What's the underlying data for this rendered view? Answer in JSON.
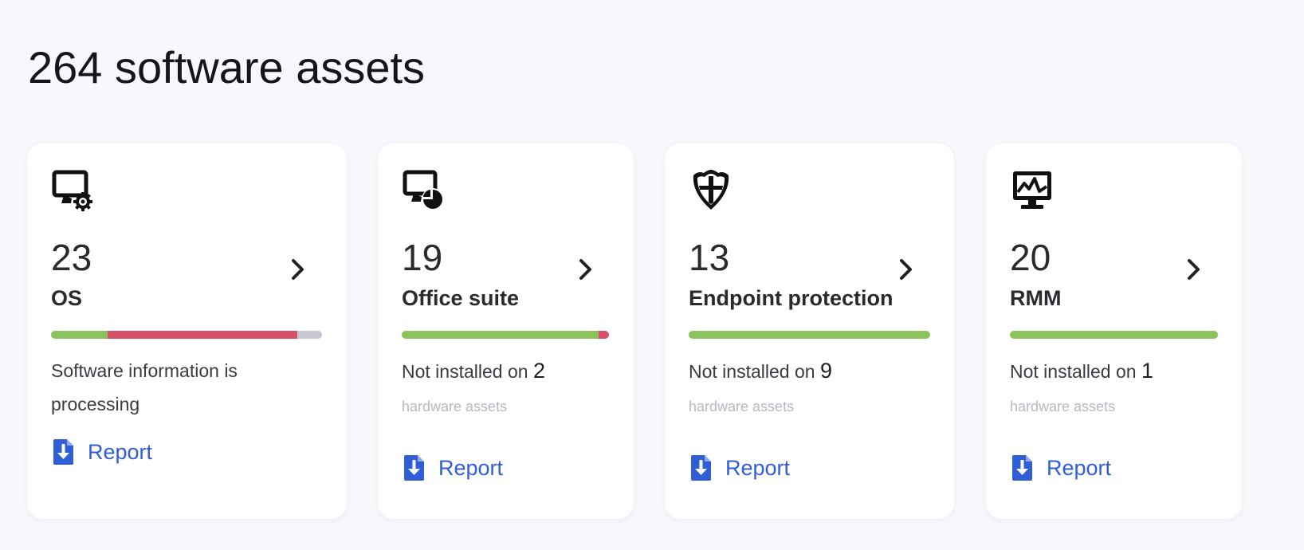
{
  "page": {
    "title": "264 software assets"
  },
  "colors": {
    "installed": "#8bc45c",
    "not_installed": "#d9506a",
    "processing": "#c8c8d2",
    "link": "#2f5ed6"
  },
  "cards": [
    {
      "icon": "monitor-gear-icon",
      "count": "23",
      "title": "OS",
      "progress": {
        "installed": 0.21,
        "not_installed": 0.7,
        "processing": 0.09
      },
      "status_text": "Software information is processing",
      "report_label": "Report"
    },
    {
      "icon": "monitor-pie-icon",
      "count": "19",
      "title": "Office suite",
      "progress": {
        "installed": 0.95,
        "not_installed": 0.05,
        "processing": 0
      },
      "status_prefix": "Not installed on",
      "status_count": "2",
      "status_sub": "hardware assets",
      "report_label": "Report"
    },
    {
      "icon": "shield-icon",
      "count": "13",
      "title": "Endpoint protection",
      "progress": {
        "installed": 1.0,
        "not_installed": 0,
        "processing": 0
      },
      "status_prefix": "Not installed on",
      "status_count": "9",
      "status_sub": "hardware assets",
      "report_label": "Report"
    },
    {
      "icon": "monitor-pulse-icon",
      "count": "20",
      "title": "RMM",
      "progress": {
        "installed": 1.0,
        "not_installed": 0,
        "processing": 0
      },
      "status_prefix": "Not installed on",
      "status_count": "1",
      "status_sub": "hardware assets",
      "report_label": "Report"
    }
  ]
}
